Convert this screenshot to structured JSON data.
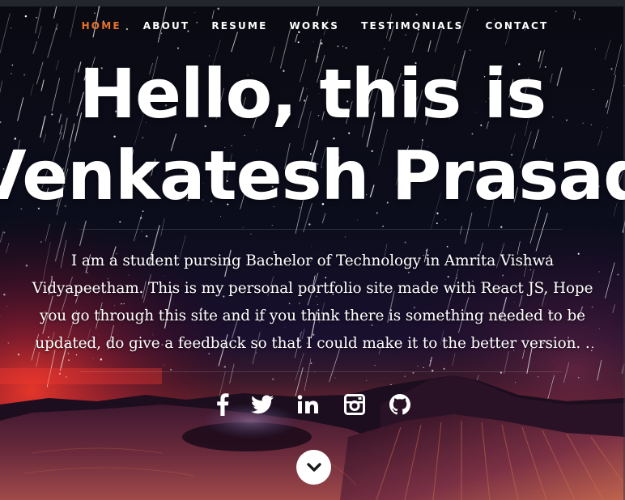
{
  "nav": {
    "items": [
      {
        "label": "HOME",
        "active": true
      },
      {
        "label": "ABOUT",
        "active": false
      },
      {
        "label": "RESUME",
        "active": false
      },
      {
        "label": "WORKS",
        "active": false
      },
      {
        "label": "TESTIMONIALS",
        "active": false
      },
      {
        "label": "CONTACT",
        "active": false
      }
    ],
    "active_color": "#e8702a"
  },
  "hero": {
    "headline_line1": "Hello, this is",
    "headline_line2": "Venkatesh Prasad",
    "description_lines": [
      "I am a student pursing Bachelor of Technology in Amrita Vishwa",
      "Vidyapeetham. This is my personal portfolio site made with React JS, Hope",
      "you go through this site and if you think there is something needed to be",
      "updated, do give a feedback so that I could make it to the better version. ."
    ]
  },
  "social": [
    {
      "icon": "facebook-icon"
    },
    {
      "icon": "twitter-icon"
    },
    {
      "icon": "linkedin-icon"
    },
    {
      "icon": "instagram-icon"
    },
    {
      "icon": "github-icon"
    }
  ],
  "scroll_icon": "chevron-down-icon"
}
